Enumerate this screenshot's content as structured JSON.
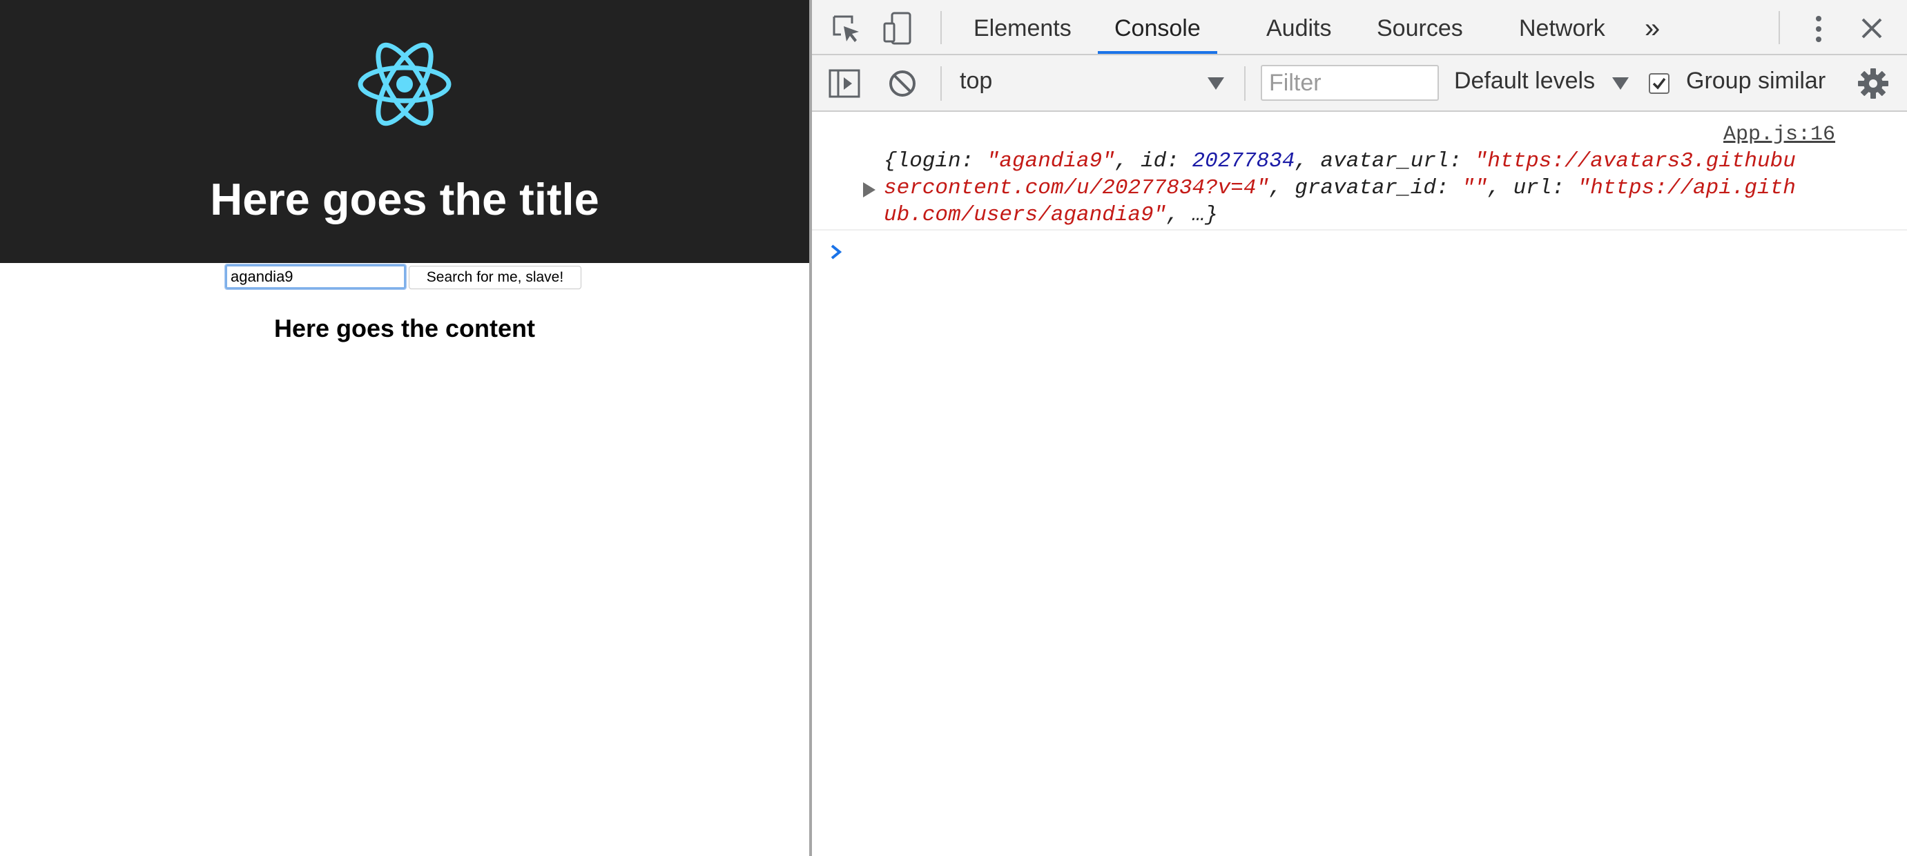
{
  "app": {
    "title": "Here goes the title",
    "search_value": "agandia9",
    "search_button": "Search for me, slave!",
    "content_heading": "Here goes the content",
    "logo_color": "#61dafb"
  },
  "devtools": {
    "tabs": [
      {
        "label": "Elements",
        "active": false
      },
      {
        "label": "Console",
        "active": true
      },
      {
        "label": "Audits",
        "active": false
      },
      {
        "label": "Sources",
        "active": false
      },
      {
        "label": "Network",
        "active": false
      }
    ],
    "more_tabs": "»",
    "accent_color": "#1a73e8",
    "toolbar": {
      "context": "top",
      "filter_placeholder": "Filter",
      "levels": "Default levels",
      "group_similar": "Group similar",
      "group_similar_checked": true
    },
    "console": {
      "source": "App.js:16",
      "line1_a": "{login: ",
      "line1_login": "\"agandia9\"",
      "line1_b": ", id: ",
      "line1_id": "20277834",
      "line1_c": ", avatar_url: ",
      "line1_url_part": "\"https://avatars3.githubu",
      "line2_url_part": "sercontent.com/u/20277834?v=4\"",
      "line2_a": ", gravatar_id: ",
      "line2_grav": "\"\"",
      "line2_b": ", url: ",
      "line2_url2_part": "\"https://api.gith",
      "line3_url2_part": "ub.com/users/agandia9\"",
      "line3_end": ", …}"
    }
  }
}
